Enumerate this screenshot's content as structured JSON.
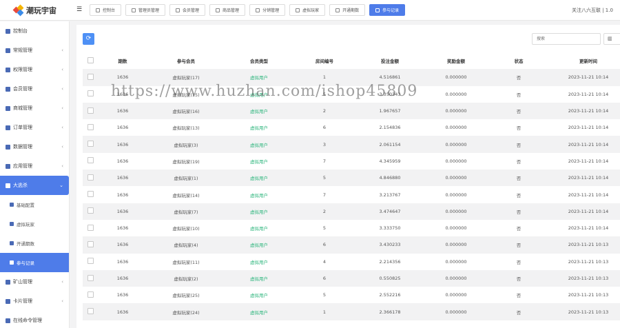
{
  "app": {
    "title": "潮玩宇宙"
  },
  "header": {
    "tabs": [
      {
        "label": "控制台",
        "active": false
      },
      {
        "label": "管理员管理",
        "active": false
      },
      {
        "label": "会员管理",
        "active": false
      },
      {
        "label": "商品管理",
        "active": false
      },
      {
        "label": "分销管理",
        "active": false
      },
      {
        "label": "虚拟玩家",
        "active": false
      },
      {
        "label": "开通期数",
        "active": false
      },
      {
        "label": "参与记录",
        "active": true
      }
    ],
    "right_text": "关注八六互联 | 1.0"
  },
  "sidebar": {
    "items": [
      {
        "label": "控制台",
        "icon": "dashboard-icon",
        "chevron": false
      },
      {
        "label": "常规管理",
        "icon": "gear-icon",
        "chevron": true
      },
      {
        "label": "权限管理",
        "icon": "users-icon",
        "chevron": true
      },
      {
        "label": "会员管理",
        "icon": "user-icon",
        "chevron": true
      },
      {
        "label": "商城管理",
        "icon": "list-icon",
        "chevron": true
      },
      {
        "label": "订单管理",
        "icon": "list-icon",
        "chevron": true
      },
      {
        "label": "数据管理",
        "icon": "gear-icon",
        "chevron": true
      },
      {
        "label": "应用管理",
        "icon": "list-icon",
        "chevron": true
      },
      {
        "label": "大逃杀",
        "icon": "game-icon",
        "chevron": true,
        "open": true
      }
    ],
    "subitems": [
      {
        "label": "基础配置",
        "icon": "gear-icon",
        "active": false
      },
      {
        "label": "虚拟玩家",
        "icon": "robot-icon",
        "active": false
      },
      {
        "label": "开通期数",
        "icon": "list-icon",
        "active": false
      },
      {
        "label": "参与记录",
        "icon": "record-icon",
        "active": true
      }
    ],
    "items_after": [
      {
        "label": "矿山管理",
        "icon": "list-icon",
        "chevron": true
      },
      {
        "label": "卡片管理",
        "icon": "list-icon",
        "chevron": true
      },
      {
        "label": "在线命令管理",
        "icon": "list-icon",
        "chevron": false
      }
    ]
  },
  "toolbar": {
    "refresh_icon": "refresh-icon",
    "search_placeholder": "搜索",
    "columns_icon": "columns-icon"
  },
  "table": {
    "headers": [
      "期数",
      "参与会员",
      "会员类型",
      "房间编号",
      "投注金额",
      "奖励金额",
      "状态",
      "更新时间"
    ],
    "rows": [
      [
        "1636",
        "虚拟玩家(17)",
        "虚拟用户",
        "1",
        "4.516861",
        "0.000000",
        "否",
        "2023-11-21 10:14"
      ],
      [
        "1636",
        "虚拟玩家(15)",
        "虚拟用户",
        "5",
        "3.350343",
        "0.000000",
        "否",
        "2023-11-21 10:14"
      ],
      [
        "1636",
        "虚拟玩家(16)",
        "虚拟用户",
        "2",
        "1.967657",
        "0.000000",
        "否",
        "2023-11-21 10:14"
      ],
      [
        "1636",
        "虚拟玩家(13)",
        "虚拟用户",
        "6",
        "2.154836",
        "0.000000",
        "否",
        "2023-11-21 10:14"
      ],
      [
        "1636",
        "虚拟玩家(3)",
        "虚拟用户",
        "3",
        "2.061154",
        "0.000000",
        "否",
        "2023-11-21 10:14"
      ],
      [
        "1636",
        "虚拟玩家(19)",
        "虚拟用户",
        "7",
        "4.345959",
        "0.000000",
        "否",
        "2023-11-21 10:14"
      ],
      [
        "1636",
        "虚拟玩家(1)",
        "虚拟用户",
        "5",
        "4.846880",
        "0.000000",
        "否",
        "2023-11-21 10:14"
      ],
      [
        "1636",
        "虚拟玩家(14)",
        "虚拟用户",
        "7",
        "3.213767",
        "0.000000",
        "否",
        "2023-11-21 10:14"
      ],
      [
        "1636",
        "虚拟玩家(7)",
        "虚拟用户",
        "2",
        "3.474647",
        "0.000000",
        "否",
        "2023-11-21 10:14"
      ],
      [
        "1636",
        "虚拟玩家(10)",
        "虚拟用户",
        "5",
        "3.333750",
        "0.000000",
        "否",
        "2023-11-21 10:14"
      ],
      [
        "1636",
        "虚拟玩家(4)",
        "虚拟用户",
        "6",
        "3.430233",
        "0.000000",
        "否",
        "2023-11-21 10:13"
      ],
      [
        "1636",
        "虚拟玩家(11)",
        "虚拟用户",
        "4",
        "2.214356",
        "0.000000",
        "否",
        "2023-11-21 10:13"
      ],
      [
        "1636",
        "虚拟玩家(2)",
        "虚拟用户",
        "6",
        "0.550825",
        "0.000000",
        "否",
        "2023-11-21 10:13"
      ],
      [
        "1636",
        "虚拟玩家(25)",
        "虚拟用户",
        "5",
        "2.552216",
        "0.000000",
        "否",
        "2023-11-21 10:13"
      ],
      [
        "1636",
        "虚拟玩家(24)",
        "虚拟用户",
        "1",
        "2.366178",
        "0.000000",
        "否",
        "2023-11-21 10:13"
      ]
    ]
  },
  "watermark": "https://www.huzhan.com/ishop45809",
  "colors": {
    "accent": "#4e7ce9",
    "user_type": "#2eb67d",
    "refresh": "#4e90f5"
  }
}
